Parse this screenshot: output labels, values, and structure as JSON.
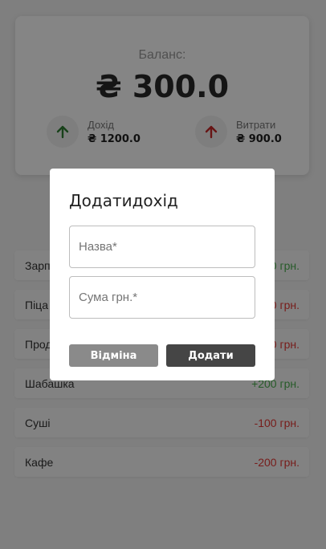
{
  "balance": {
    "label": "Баланс:",
    "value": "₴ 300.0"
  },
  "income": {
    "title": "Дохід",
    "amount": "₴ 1200.0",
    "icon": "arrow-up-icon",
    "color": "#2e7d32"
  },
  "expense": {
    "title": "Витрати",
    "amount": "₴ 900.0",
    "icon": "arrow-up-icon",
    "color": "#c62828"
  },
  "transactions": [
    {
      "name": "Зарплата",
      "amount": "+1000 грн.",
      "type": "income"
    },
    {
      "name": "Піца",
      "amount": "-200 грн.",
      "type": "expense"
    },
    {
      "name": "Продукти",
      "amount": "-400 грн.",
      "type": "expense"
    },
    {
      "name": "Шабашка",
      "amount": "+200 грн.",
      "type": "income"
    },
    {
      "name": "Суші",
      "amount": "-100 грн.",
      "type": "expense"
    },
    {
      "name": "Кафе",
      "amount": "-200 грн.",
      "type": "expense"
    }
  ],
  "colors": {
    "income_text": "#4caf50",
    "expense_text": "#e53935"
  },
  "modal": {
    "title": "Додатидохід",
    "name_placeholder": "Назва*",
    "name_value": "",
    "amount_placeholder": "Сума грн.*",
    "amount_value": "",
    "cancel_label": "Відміна",
    "submit_label": "Додати"
  }
}
